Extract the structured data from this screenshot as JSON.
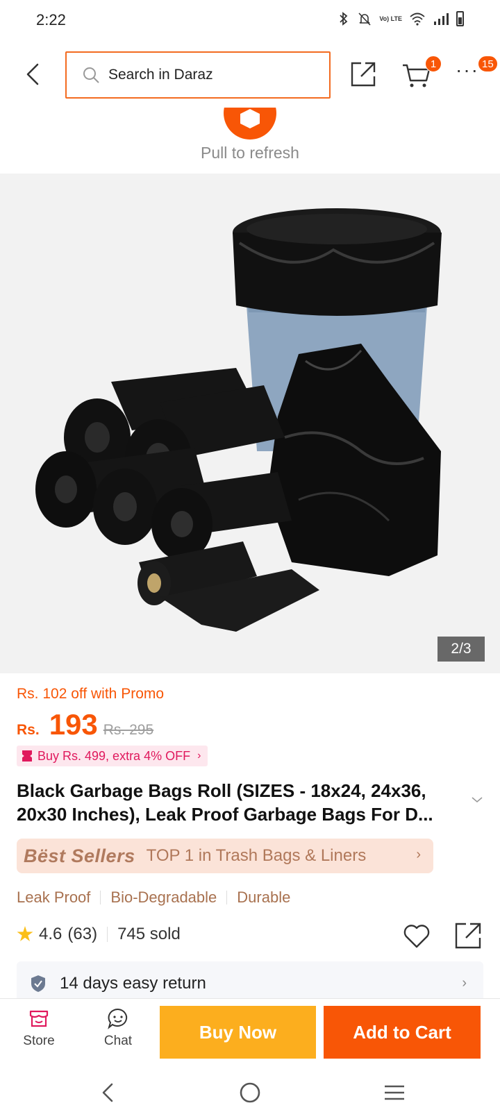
{
  "status_bar": {
    "time": "2:22",
    "network_label": "Vo) LTE"
  },
  "header": {
    "search_placeholder": "Search in Daraz",
    "cart_count": "1",
    "more_count": "15"
  },
  "refresh": {
    "text": "Pull to refresh"
  },
  "gallery": {
    "counter": "2/3"
  },
  "price": {
    "promo_text": "Rs. 102 off with Promo",
    "currency": "Rs.",
    "current": "193",
    "original": "Rs. 295",
    "voucher_text": "Buy Rs. 499, extra 4% OFF"
  },
  "product": {
    "title": "Black Garbage Bags Roll (SIZES - 18x24, 24x36, 20x30 Inches), Leak Proof Garbage Bags For D...",
    "best_sellers_logo": "Bëst Sellers",
    "best_sellers_text": "TOP 1 in Trash Bags & Liners",
    "tags": [
      "Leak Proof",
      "Bio-Degradable",
      "Durable"
    ],
    "rating": "4.6",
    "review_count": "(63)",
    "sold": "745 sold",
    "return_policy": "14 days easy return"
  },
  "action_bar": {
    "store_label": "Store",
    "chat_label": "Chat",
    "buy_now": "Buy Now",
    "add_to_cart": "Add to Cart"
  },
  "colors": {
    "brand": "#f85606",
    "buy_now": "#fcae1e",
    "search_border": "#f36b20",
    "voucher": "#e0195d",
    "rating_star": "#fbbf18"
  }
}
